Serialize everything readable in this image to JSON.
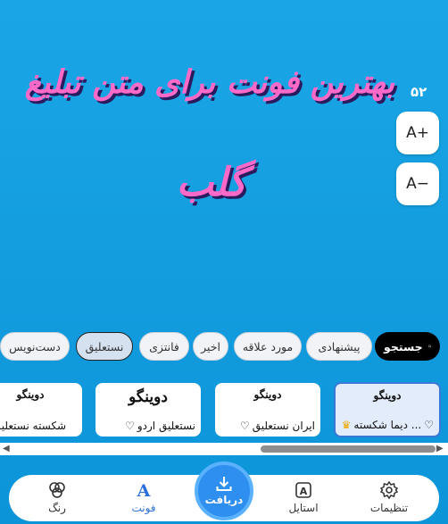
{
  "preview": {
    "line1": "بهترین فونت برای متن تبلیغ",
    "line2": "گلب",
    "text_color": "#ff69c8",
    "shadow_color": "#2a1a5e"
  },
  "size": {
    "value": "۵۲",
    "increase_label": "A+",
    "decrease_label": "A−"
  },
  "filters": {
    "search_label": "جستجو",
    "chips": [
      "پیشنهادی",
      "مورد علاقه",
      "اخیر",
      "فانتزی",
      "نستعلیق",
      "دست‌نویس"
    ],
    "selected": "نستعلیق"
  },
  "fonts": [
    {
      "sample": "دوینگو",
      "name": "دیما شکسته ..."
    },
    {
      "sample": "دوینگو",
      "name": "ایران نستعلیق"
    },
    {
      "sample": "دوینگو",
      "name": "نستعلیق اردو"
    },
    {
      "sample": "دوینگو",
      "name": "شکسته نستعلیق"
    }
  ],
  "nav": {
    "settings": "تنظیمات",
    "style": "استایل",
    "download": "دریافت",
    "font": "فونت",
    "color": "رنگ"
  },
  "colors": {
    "accent": "#2b6fdc",
    "background": "#1aa6e6"
  }
}
